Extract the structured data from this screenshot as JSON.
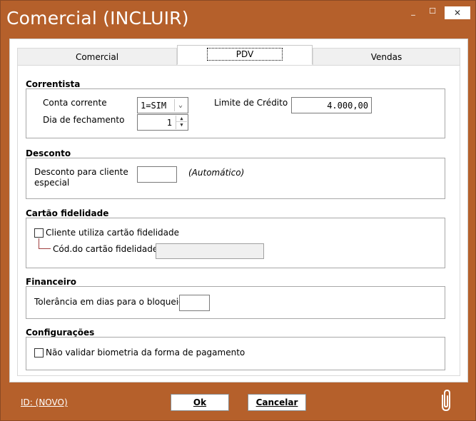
{
  "window": {
    "title": "Comercial (INCLUIR)",
    "minimize": "_",
    "maximize": "☐",
    "close": "✕"
  },
  "tabs": [
    {
      "label": "Comercial"
    },
    {
      "label": "PDV"
    },
    {
      "label": "Vendas"
    }
  ],
  "correntista": {
    "title": "Correntista",
    "conta_corrente_label": "Conta corrente",
    "conta_corrente_value": "1=SIM",
    "dia_fechamento_label": "Dia de fechamento",
    "dia_fechamento_value": "1",
    "limite_label": "Limite de Crédito",
    "limite_value": "4.000,00"
  },
  "desconto": {
    "title": "Desconto",
    "label_line1": "Desconto para cliente",
    "label_line2": "especial",
    "value": "",
    "hint": "(Automático)"
  },
  "fidelidade": {
    "title": "Cartão fidelidade",
    "checkbox_label": "Cliente utiliza cartão fidelidade",
    "checked": false,
    "cod_label": "Cód.do cartão fidelidade",
    "cod_value": ""
  },
  "financeiro": {
    "title": "Financeiro",
    "tolerancia_label": "Tolerância em dias para o bloqueio",
    "tolerancia_value": ""
  },
  "configuracoes": {
    "title": "Configurações",
    "biometria_label": "Não validar biometria da forma de pagamento",
    "checked": false
  },
  "footer": {
    "id_link": "ID: (NOVO)",
    "ok_label": "Ok",
    "cancel_label": "Cancelar"
  }
}
